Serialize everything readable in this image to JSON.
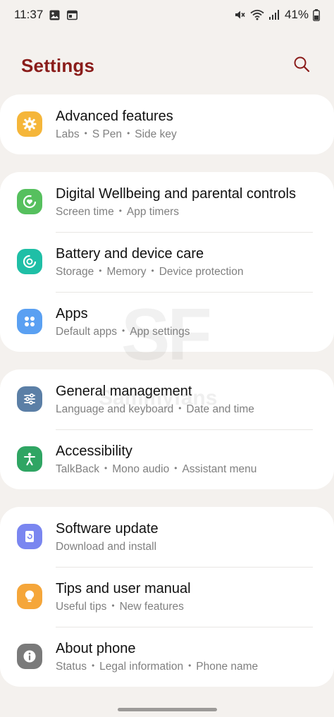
{
  "status": {
    "time": "11:37",
    "battery": "41%"
  },
  "header": {
    "title": "Settings"
  },
  "watermark": {
    "logo": "SF",
    "text": "Sammyfans"
  },
  "groups": [
    {
      "items": [
        {
          "title": "Advanced features",
          "subtitles": [
            "Labs",
            "S Pen",
            "Side key"
          ],
          "icon": "advanced-features-icon",
          "color": "#f5b63a"
        }
      ]
    },
    {
      "items": [
        {
          "title": "Digital Wellbeing and parental controls",
          "subtitles": [
            "Screen time",
            "App timers"
          ],
          "icon": "digital-wellbeing-icon",
          "color": "#56c05e"
        },
        {
          "title": "Battery and device care",
          "subtitles": [
            "Storage",
            "Memory",
            "Device protection"
          ],
          "icon": "device-care-icon",
          "color": "#1fbfa6"
        },
        {
          "title": "Apps",
          "subtitles": [
            "Default apps",
            "App settings"
          ],
          "icon": "apps-icon",
          "color": "#5aa0f2"
        }
      ]
    },
    {
      "items": [
        {
          "title": "General management",
          "subtitles": [
            "Language and keyboard",
            "Date and time"
          ],
          "icon": "general-management-icon",
          "color": "#5b7fa6"
        },
        {
          "title": "Accessibility",
          "subtitles": [
            "TalkBack",
            "Mono audio",
            "Assistant menu"
          ],
          "icon": "accessibility-icon",
          "color": "#2fa563"
        }
      ]
    },
    {
      "items": [
        {
          "title": "Software update",
          "subtitles": [
            "Download and install"
          ],
          "icon": "software-update-icon",
          "color": "#7a86f0"
        },
        {
          "title": "Tips and user manual",
          "subtitles": [
            "Useful tips",
            "New features"
          ],
          "icon": "tips-icon",
          "color": "#f5a63a"
        },
        {
          "title": "About phone",
          "subtitles": [
            "Status",
            "Legal information",
            "Phone name"
          ],
          "icon": "about-phone-icon",
          "color": "#7a7a7a"
        }
      ]
    }
  ]
}
